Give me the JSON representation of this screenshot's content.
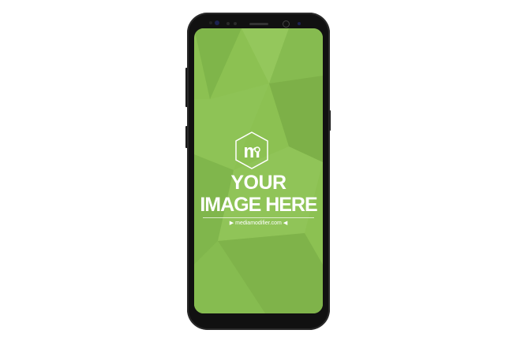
{
  "mockup": {
    "headline_line1": "YOUR",
    "headline_line2": "IMAGE HERE",
    "website": "mediamodifier.com",
    "logo_letter": "m",
    "screen_color": "#8cc152",
    "body_color": "#111111"
  }
}
